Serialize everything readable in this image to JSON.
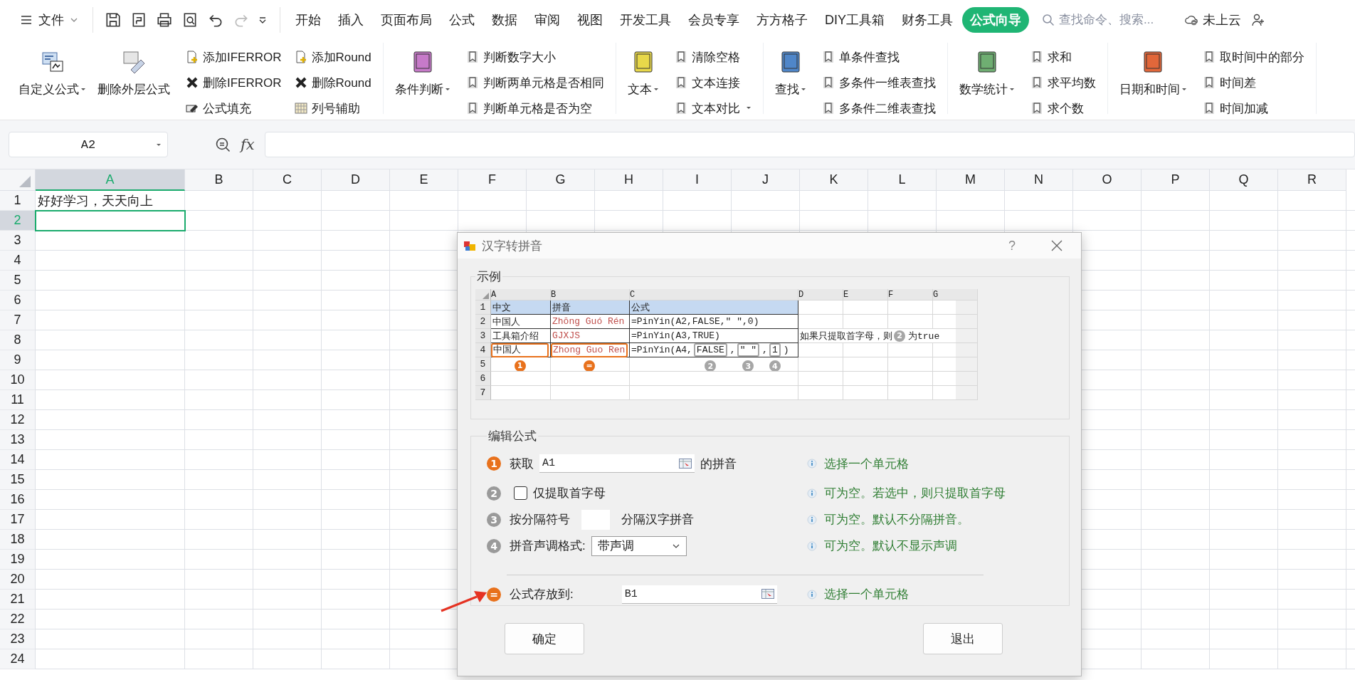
{
  "menu_bar": {
    "file_menu": "文件",
    "tabs": [
      {
        "label": "开始",
        "selected": false
      },
      {
        "label": "插入",
        "selected": false
      },
      {
        "label": "页面布局",
        "selected": false
      },
      {
        "label": "公式",
        "selected": false
      },
      {
        "label": "数据",
        "selected": false
      },
      {
        "label": "审阅",
        "selected": false
      },
      {
        "label": "视图",
        "selected": false
      },
      {
        "label": "开发工具",
        "selected": false
      },
      {
        "label": "会员专享",
        "selected": false
      },
      {
        "label": "方方格子",
        "selected": false
      },
      {
        "label": "DIY工具箱",
        "selected": false
      },
      {
        "label": "财务工具",
        "selected": false
      },
      {
        "label": "公式向导",
        "selected": true
      }
    ],
    "search": {
      "placeholder": "查找命令、搜索..."
    },
    "cloud_status": "未上云"
  },
  "ribbon": {
    "groups": [
      {
        "large_buttons": [
          {
            "label": "自定义公式",
            "dropdown": true,
            "kind": "custom"
          },
          {
            "label": "删除外层公式",
            "dropdown": false,
            "kind": "eraser"
          }
        ],
        "small_items": [
          {
            "label": "添加IFERROR",
            "kind": "add",
            "dropdown": false
          },
          {
            "label": "删除IFERROR",
            "kind": "delete",
            "dropdown": false
          },
          {
            "label": "公式填充",
            "kind": "fill",
            "dropdown": false
          },
          {
            "label": "添加Round",
            "kind": "add",
            "dropdown": false
          },
          {
            "label": "删除Round",
            "kind": "delete",
            "dropdown": false
          },
          {
            "label": "列号辅助",
            "kind": "grid",
            "dropdown": false
          }
        ]
      },
      {
        "large_buttons": [
          {
            "label": "条件判断",
            "dropdown": true,
            "kind": "book",
            "color": "#c77ac9"
          }
        ],
        "small_items": [
          {
            "label": "判断数字大小",
            "kind": "bookmark",
            "dropdown": false
          },
          {
            "label": "判断两单元格是否相同",
            "kind": "bookmark",
            "dropdown": false
          },
          {
            "label": "判断单元格是否为空",
            "kind": "bookmark",
            "dropdown": false
          }
        ]
      },
      {
        "large_buttons": [
          {
            "label": "文本",
            "dropdown": true,
            "kind": "book",
            "color": "#e8d84a"
          }
        ],
        "small_items": [
          {
            "label": "清除空格",
            "kind": "bookmark",
            "dropdown": false
          },
          {
            "label": "文本连接",
            "kind": "bookmark",
            "dropdown": false
          },
          {
            "label": "文本对比",
            "kind": "bookmark",
            "dropdown": true
          }
        ]
      },
      {
        "large_buttons": [
          {
            "label": "查找",
            "dropdown": true,
            "kind": "book",
            "color": "#4f86c9"
          }
        ],
        "small_items": [
          {
            "label": "单条件查找",
            "kind": "bookmark",
            "dropdown": false
          },
          {
            "label": "多条件一维表查找",
            "kind": "bookmark",
            "dropdown": false
          },
          {
            "label": "多条件二维表查找",
            "kind": "bookmark",
            "dropdown": false
          }
        ]
      },
      {
        "large_buttons": [
          {
            "label": "数学统计",
            "dropdown": true,
            "kind": "book",
            "color": "#6fae72"
          }
        ],
        "small_items": [
          {
            "label": "求和",
            "kind": "bookmark",
            "dropdown": false
          },
          {
            "label": "求平均数",
            "kind": "bookmark",
            "dropdown": false
          },
          {
            "label": "求个数",
            "kind": "bookmark",
            "dropdown": false
          }
        ]
      },
      {
        "large_buttons": [
          {
            "label": "日期和时间",
            "dropdown": true,
            "kind": "book",
            "color": "#e2673a"
          }
        ],
        "small_items": [
          {
            "label": "取时间中的部分",
            "kind": "bookmark",
            "dropdown": false
          },
          {
            "label": "时间差",
            "kind": "bookmark",
            "dropdown": false
          },
          {
            "label": "时间加减",
            "kind": "bookmark",
            "dropdown": false
          }
        ]
      }
    ]
  },
  "formula_bar": {
    "name_box": "A2",
    "fx_label": "fx"
  },
  "sheet": {
    "columns": [
      {
        "label": "A",
        "selected": true
      },
      {
        "label": "B",
        "selected": false
      },
      {
        "label": "C",
        "selected": false
      },
      {
        "label": "D",
        "selected": false
      },
      {
        "label": "E",
        "selected": false
      },
      {
        "label": "F",
        "selected": false
      },
      {
        "label": "G",
        "selected": false
      },
      {
        "label": "H",
        "selected": false
      },
      {
        "label": "I",
        "selected": false
      },
      {
        "label": "J",
        "selected": false
      },
      {
        "label": "K",
        "selected": false
      },
      {
        "label": "L",
        "selected": false
      },
      {
        "label": "M",
        "selected": false
      },
      {
        "label": "N",
        "selected": false
      },
      {
        "label": "O",
        "selected": false
      },
      {
        "label": "P",
        "selected": false
      },
      {
        "label": "Q",
        "selected": false
      },
      {
        "label": "R",
        "selected": false
      }
    ],
    "rows": [
      {
        "label": "1",
        "selected": false,
        "cells": [
          "好好学习，天天向上"
        ]
      },
      {
        "label": "2",
        "selected": true
      },
      {
        "label": "3",
        "selected": false
      },
      {
        "label": "4",
        "selected": false
      },
      {
        "label": "5",
        "selected": false
      },
      {
        "label": "6",
        "selected": false
      },
      {
        "label": "7",
        "selected": false
      },
      {
        "label": "8",
        "selected": false
      },
      {
        "label": "9",
        "selected": false
      },
      {
        "label": "10",
        "selected": false
      },
      {
        "label": "11",
        "selected": false
      },
      {
        "label": "12",
        "selected": false
      },
      {
        "label": "13",
        "selected": false
      },
      {
        "label": "14",
        "selected": false
      },
      {
        "label": "15",
        "selected": false
      },
      {
        "label": "16",
        "selected": false
      },
      {
        "label": "17",
        "selected": false
      },
      {
        "label": "18",
        "selected": false
      },
      {
        "label": "19",
        "selected": false
      },
      {
        "label": "20",
        "selected": false
      },
      {
        "label": "21",
        "selected": false
      },
      {
        "label": "22",
        "selected": false
      },
      {
        "label": "23",
        "selected": false
      },
      {
        "label": "24",
        "selected": false
      }
    ]
  },
  "dialog": {
    "title": "汉字转拼音",
    "help": "?",
    "example": {
      "legend": "示例",
      "columns": [
        "A",
        "B",
        "C",
        "D",
        "E",
        "F",
        "G"
      ],
      "rows": [
        {
          "label": "1",
          "cells": [
            {
              "kind": "header",
              "text": "中文"
            },
            {
              "kind": "header",
              "text": "拼音"
            },
            {
              "kind": "header",
              "text": "公式"
            }
          ]
        },
        {
          "label": "2",
          "cells": [
            {
              "kind": "text",
              "text": "中国人"
            },
            {
              "kind": "text",
              "text": "Zhōng Guó Rén",
              "color": "#c0504d"
            },
            {
              "kind": "text",
              "text": "=PinYin(A2,FALSE,″ ″,0)"
            }
          ]
        },
        {
          "label": "3",
          "cells": [
            {
              "kind": "text",
              "text": "工具箱介绍"
            },
            {
              "kind": "text",
              "text": "GJXJS",
              "color": "#c0504d"
            },
            {
              "kind": "text",
              "text": "=PinYin(A3,TRUE)"
            },
            {
              "kind": "note",
              "parts": [
                {
                  "text": "如果只提取首字母，则"
                },
                {
                  "badge": {
                    "label": "2",
                    "color": "#a6a6a6"
                  }
                },
                {
                  "text": "为true"
                }
              ]
            }
          ]
        },
        {
          "label": "4",
          "cells": [
            {
              "kind": "boxed",
              "text": "中国人",
              "badge": {
                "label": "1",
                "color": "#e8711c"
              }
            },
            {
              "kind": "boxed",
              "text": "Zhong Guo Ren",
              "color": "#c0504d",
              "badge": {
                "label": "=",
                "color": "#e8711c"
              }
            },
            {
              "kind": "segments",
              "parts": [
                {
                  "text": "=PinYin(A4,"
                },
                {
                  "text": "FALSE",
                  "badge": {
                    "label": "2",
                    "color": "#a6a6a6"
                  }
                },
                {
                  "text": ","
                },
                {
                  "text": "″ ″",
                  "badge": {
                    "label": "3",
                    "color": "#a6a6a6"
                  }
                },
                {
                  "text": ","
                },
                {
                  "text": "1",
                  "badge": {
                    "label": "4",
                    "color": "#a6a6a6"
                  }
                },
                {
                  "text": ")"
                }
              ]
            }
          ]
        },
        {
          "label": "5"
        },
        {
          "label": "6"
        },
        {
          "label": "7"
        }
      ]
    },
    "edit": {
      "legend": "编辑公式",
      "rows": [
        {
          "kind": "cell_ref",
          "badge": {
            "label": "1",
            "color": "#e8711c"
          },
          "label": "获取",
          "value": "A1",
          "suffix": "的拼音",
          "hint": "选择一个单元格"
        },
        {
          "kind": "checkbox",
          "badge": {
            "label": "2",
            "color": "#9a9a9a"
          },
          "label": "仅提取首字母",
          "checked": false,
          "hint": "可为空。若选中，则只提取首字母"
        },
        {
          "kind": "text_input",
          "badge": {
            "label": "3",
            "color": "#9a9a9a"
          },
          "label": "按分隔符号",
          "suffix": "分隔汉字拼音",
          "hint": "可为空。默认不分隔拼音。"
        },
        {
          "kind": "select",
          "badge": {
            "label": "4",
            "color": "#9a9a9a"
          },
          "label": "拼音声调格式:",
          "value": "带声调",
          "hint": "可为空。默认不显示声调"
        },
        {
          "kind": "target",
          "badge": {
            "label": "=",
            "color": "#e8711c"
          },
          "label": "公式存放到:",
          "value": "B1",
          "hint": "选择一个单元格"
        }
      ]
    },
    "buttons": [
      "确定",
      "退出"
    ]
  }
}
